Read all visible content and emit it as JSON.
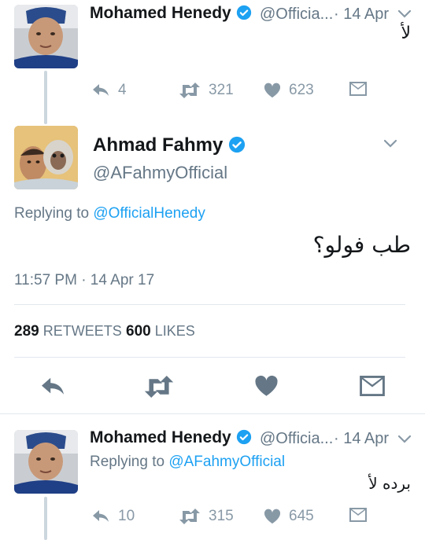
{
  "tweet1": {
    "name": "Mohamed Henedy",
    "handle": "@Officia...",
    "separator": "·",
    "date": "14 Apr",
    "text": "لأ",
    "reply_count": "4",
    "retweet_count": "321",
    "like_count": "623"
  },
  "main_tweet": {
    "name": "Ahmad Fahmy",
    "handle": "@AFahmyOfficial",
    "replying_prefix": "Replying to ",
    "replying_to": "@OfficialHenedy",
    "text": "طب فولو؟",
    "timestamp": "11:57 PM · 14 Apr 17",
    "retweets_count": "289",
    "retweets_label": "RETWEETS",
    "likes_count": "600",
    "likes_label": "LIKES"
  },
  "tweet3": {
    "name": "Mohamed Henedy",
    "handle": "@Officia...",
    "separator": "·",
    "date": "14 Apr",
    "replying_prefix": "Replying to ",
    "replying_to": "@AFahmyOfficial",
    "text": "برده لأ",
    "reply_count": "10",
    "retweet_count": "315",
    "like_count": "645"
  },
  "colors": {
    "accent": "#1da1f2",
    "muted": "#657786",
    "icon": "#8899a6",
    "divider": "#e1e8ed"
  },
  "icons": [
    "verified-badge-icon",
    "chevron-down-icon",
    "reply-icon",
    "retweet-icon",
    "heart-icon",
    "direct-message-icon"
  ]
}
